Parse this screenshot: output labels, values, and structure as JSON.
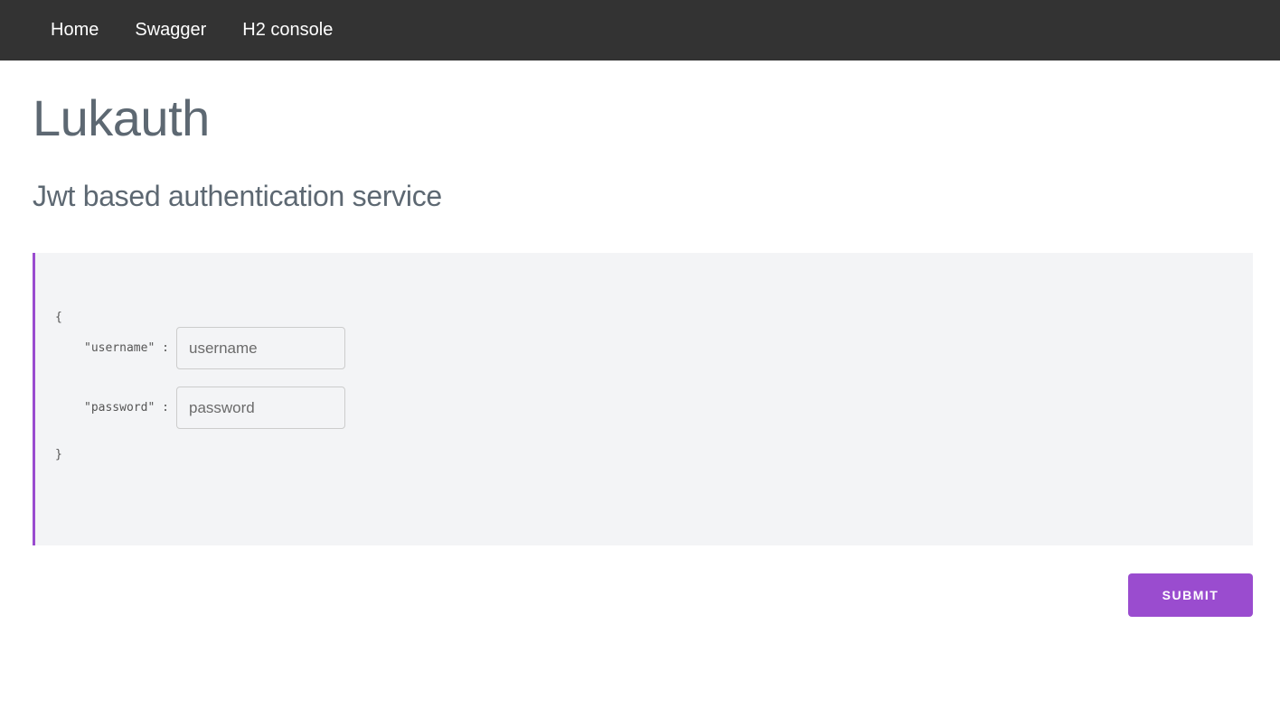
{
  "nav": {
    "items": [
      {
        "label": "Home"
      },
      {
        "label": "Swagger"
      },
      {
        "label": "H2 console"
      }
    ]
  },
  "header": {
    "title": "Lukauth",
    "subtitle": "Jwt based authentication service"
  },
  "form": {
    "open_brace": "{",
    "close_brace": "}",
    "username": {
      "key": "\"username\" :",
      "placeholder": "username",
      "value": ""
    },
    "password": {
      "key": "\"password\" :",
      "placeholder": "password",
      "value": ""
    },
    "submit_label": "SUBMIT"
  },
  "colors": {
    "navbar_bg": "#333333",
    "accent": "#9a4ccf",
    "heading_text": "#5d6872",
    "code_bg": "#f3f4f6"
  }
}
